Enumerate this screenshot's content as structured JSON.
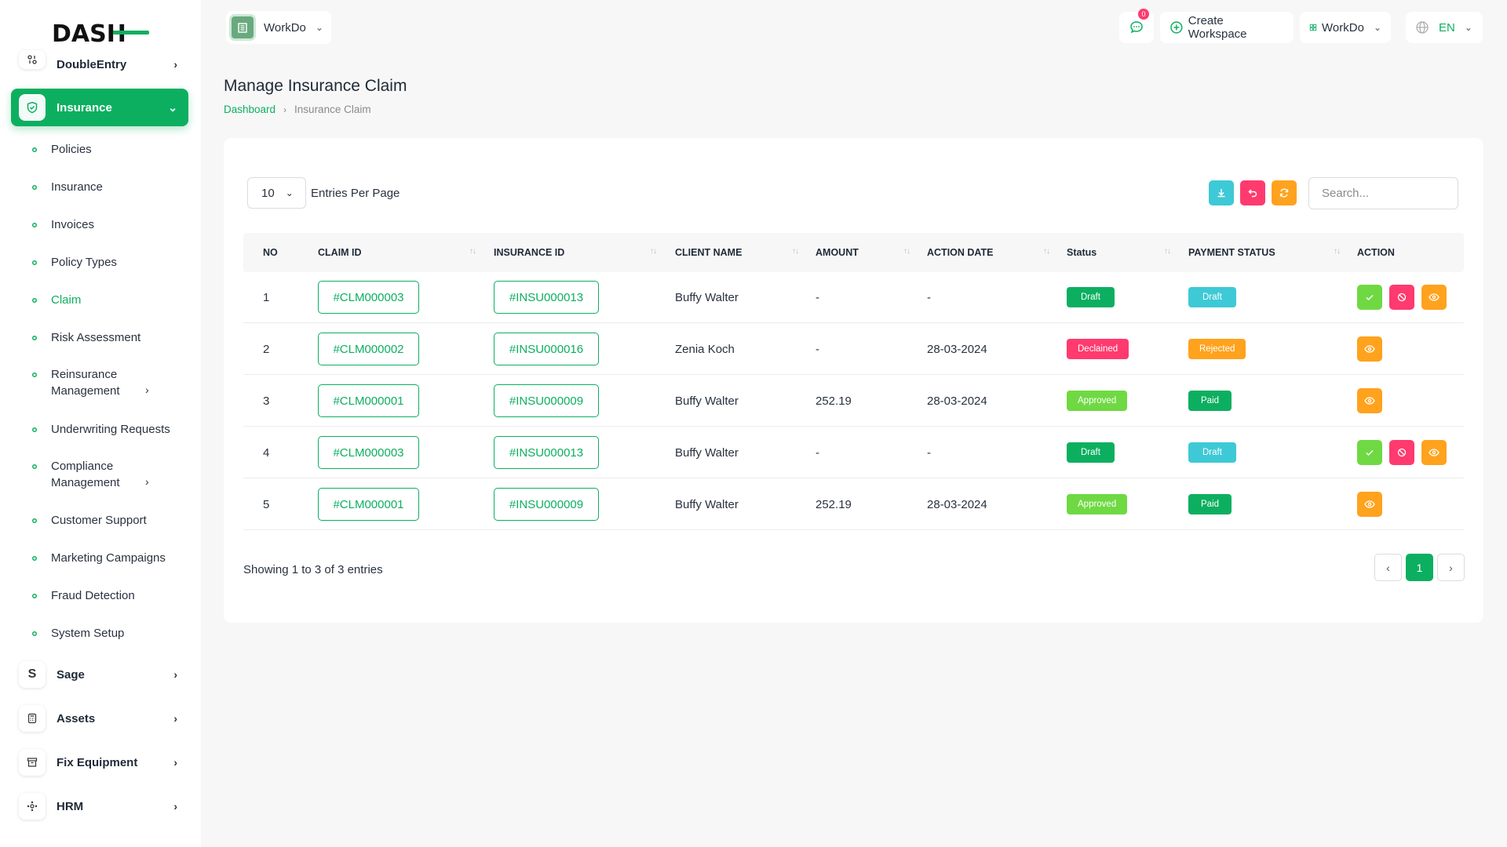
{
  "brand": {
    "logo_text": "DASH"
  },
  "sidebar": {
    "top_partial": "DoubleEntry",
    "active_module": "Insurance",
    "sub_items": [
      {
        "label": "Policies"
      },
      {
        "label": "Insurance"
      },
      {
        "label": "Invoices"
      },
      {
        "label": "Policy Types"
      },
      {
        "label": "Claim"
      },
      {
        "label": "Risk Assessment"
      },
      {
        "label": "Reinsurance Management"
      },
      {
        "label": "Underwriting Requests"
      },
      {
        "label": "Compliance Management"
      },
      {
        "label": "Customer Support"
      },
      {
        "label": "Marketing Campaigns"
      },
      {
        "label": "Fraud Detection"
      },
      {
        "label": "System Setup"
      }
    ],
    "modules": [
      {
        "label": "Sage",
        "icon": "s-icon"
      },
      {
        "label": "Assets",
        "icon": "calculator-icon"
      },
      {
        "label": "Fix Equipment",
        "icon": "archive-icon"
      },
      {
        "label": "HRM",
        "icon": "hrm-icon"
      }
    ]
  },
  "header": {
    "workspace": "WorkDo",
    "notification_count": "0",
    "create_workspace": "Create Workspace",
    "user_workspace": "WorkDo",
    "language": "EN"
  },
  "page": {
    "title": "Manage Insurance Claim",
    "breadcrumb_home": "Dashboard",
    "breadcrumb_current": "Insurance Claim"
  },
  "table": {
    "per_page": "10",
    "per_page_label": "Entries Per Page",
    "search_placeholder": "Search...",
    "columns": [
      "NO",
      "CLAIM ID",
      "INSURANCE ID",
      "CLIENT NAME",
      "AMOUNT",
      "ACTION DATE",
      "Status",
      "PAYMENT STATUS",
      "ACTION"
    ],
    "rows": [
      {
        "no": "1",
        "claim_id": "#CLM000003",
        "insurance_id": "#INSU000013",
        "client": "Buffy Walter",
        "amount": "-",
        "date": "-",
        "status": "Draft",
        "payment": "Draft"
      },
      {
        "no": "2",
        "claim_id": "#CLM000002",
        "insurance_id": "#INSU000016",
        "client": "Zenia Koch",
        "amount": "-",
        "date": "28-03-2024",
        "status": "Declained",
        "payment": "Rejected"
      },
      {
        "no": "3",
        "claim_id": "#CLM000001",
        "insurance_id": "#INSU000009",
        "client": "Buffy Walter",
        "amount": "252.19",
        "date": "28-03-2024",
        "status": "Approved",
        "payment": "Paid"
      },
      {
        "no": "4",
        "claim_id": "#CLM000003",
        "insurance_id": "#INSU000013",
        "client": "Buffy Walter",
        "amount": "-",
        "date": "-",
        "status": "Draft",
        "payment": "Draft"
      },
      {
        "no": "5",
        "claim_id": "#CLM000001",
        "insurance_id": "#INSU000009",
        "client": "Buffy Walter",
        "amount": "252.19",
        "date": "28-03-2024",
        "status": "Approved",
        "payment": "Paid"
      }
    ],
    "showing": "Showing 1 to 3 of 3 entries",
    "current_page": "1"
  },
  "colors": {
    "primary": "#0caf60",
    "info": "#3ec9d6",
    "danger": "#ff3a6e",
    "warning": "#ffa21d",
    "success_light": "#6fd943"
  }
}
